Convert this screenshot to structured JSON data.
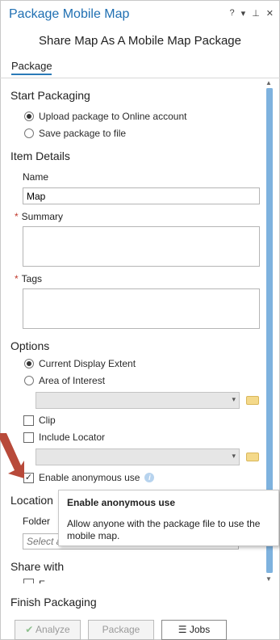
{
  "window": {
    "title": "Package Mobile Map",
    "controls": [
      "?",
      "▾",
      "⊥",
      "✕"
    ]
  },
  "tool_title": "Share Map As A Mobile Map Package",
  "tab": {
    "label": "Package"
  },
  "start_packaging": {
    "heading": "Start Packaging",
    "options": [
      {
        "label": "Upload package to Online account",
        "selected": true
      },
      {
        "label": "Save package to file",
        "selected": false
      }
    ]
  },
  "item_details": {
    "heading": "Item Details",
    "name_label": "Name",
    "name_value": "Map",
    "summary_label": "Summary",
    "summary_value": "",
    "tags_label": "Tags",
    "tags_value": "",
    "required_marker": "*"
  },
  "options": {
    "heading": "Options",
    "extent_options": [
      {
        "label": "Current Display Extent",
        "selected": true
      },
      {
        "label": "Area of Interest",
        "selected": false
      }
    ],
    "clip_label": "Clip",
    "clip_checked": false,
    "include_locator_label": "Include Locator",
    "include_locator_checked": false,
    "anonymous_label": "Enable anonymous use",
    "anonymous_checked": true
  },
  "location": {
    "heading": "Location",
    "folder_label": "Folder",
    "folder_placeholder": "Select a"
  },
  "share_with": {
    "heading": "Share with",
    "partial_item": "E"
  },
  "finish_packaging": {
    "heading": "Finish Packaging",
    "analyze_label": "Analyze",
    "package_label": "Package",
    "jobs_label": "Jobs"
  },
  "tooltip": {
    "title": "Enable anonymous use",
    "body": "Allow anyone with the package file to use the mobile map."
  },
  "colors": {
    "accent": "#1f6fb2",
    "required": "#c0392b",
    "annotation_arrow": "#b84a3a"
  }
}
